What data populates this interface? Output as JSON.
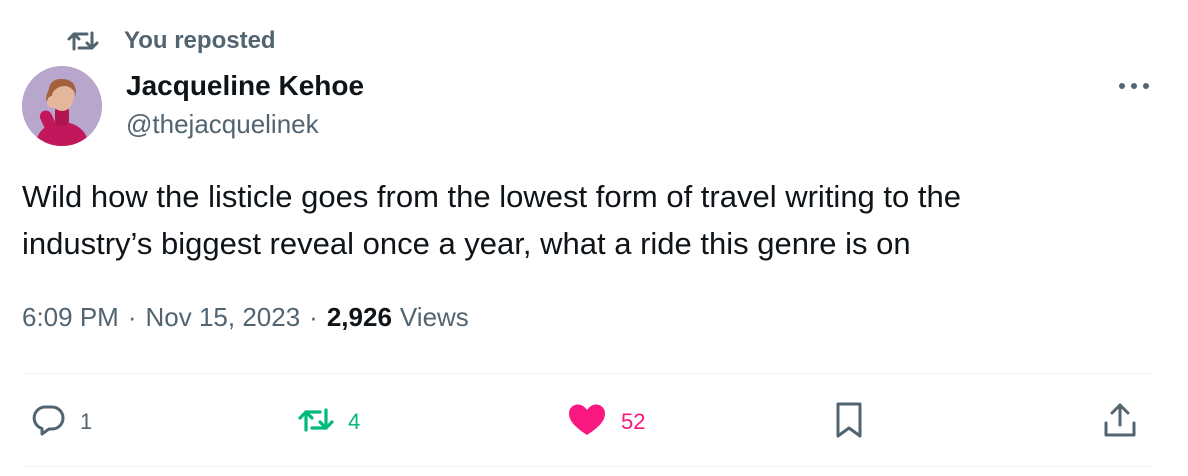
{
  "repost_banner": {
    "label": "You reposted",
    "icon": "repost-icon"
  },
  "author": {
    "name": "Jacqueline Kehoe",
    "handle": "@thejacquelinek",
    "avatar_icon": "profile-photo"
  },
  "more_icon": "ellipsis-icon",
  "tweet": {
    "line1": "Wild how the listicle goes from the lowest form of travel writing to the",
    "line2": "industry’s biggest reveal once a year, what a ride this genre is on"
  },
  "meta": {
    "time": "6:09 PM",
    "separator": "·",
    "date": "Nov 15, 2023",
    "views_count": "2,926",
    "views_label": "Views"
  },
  "actions": {
    "reply": {
      "icon": "reply-icon",
      "count": "1"
    },
    "repost": {
      "icon": "repost-icon",
      "count": "4",
      "active": true
    },
    "like": {
      "icon": "heart-icon",
      "count": "52",
      "active": true
    },
    "bookmark": {
      "icon": "bookmark-icon"
    },
    "share": {
      "icon": "share-icon"
    }
  },
  "colors": {
    "secondary_text": "#536471",
    "primary_text": "#0f1419",
    "repost_green": "#00ba7c",
    "like_pink": "#f91880",
    "divider": "#eff3f4"
  }
}
